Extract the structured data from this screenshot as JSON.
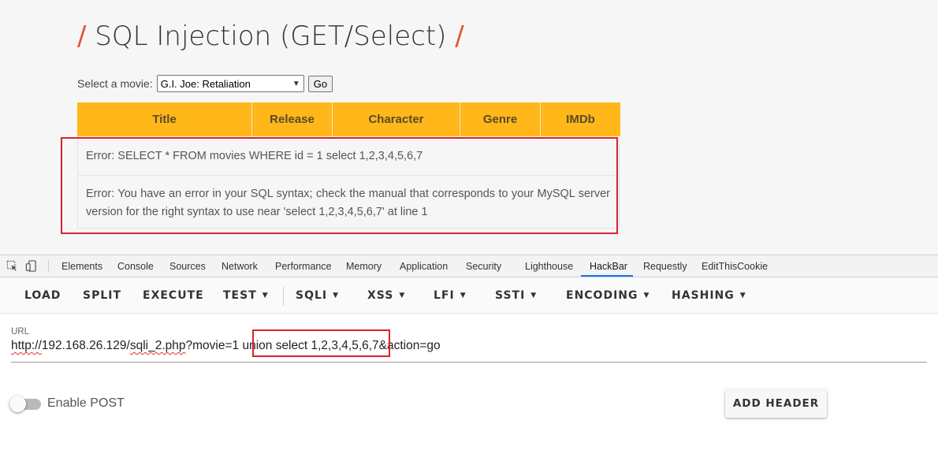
{
  "page": {
    "title": "SQL Injection (GET/Select)",
    "slash": "/",
    "select_label": "Select a movie:",
    "selected_movie": "G.I. Joe: Retaliation",
    "go_label": "Go",
    "table_headers": [
      "Title",
      "Release",
      "Character",
      "Genre",
      "IMDb"
    ],
    "error_1": "Error: SELECT * FROM movies WHERE id = 1 select 1,2,3,4,5,6,7",
    "error_2": "Error: You have an error in your SQL syntax; check the manual that corresponds to your MySQL server version for the right syntax to use near 'select 1,2,3,4,5,6,7' at line 1"
  },
  "devtools": {
    "tabs": [
      "Elements",
      "Console",
      "Sources",
      "Network",
      "Performance",
      "Memory",
      "Application",
      "Security",
      "Lighthouse",
      "HackBar",
      "Requestly",
      "EditThisCookie"
    ],
    "active_tab": "HackBar"
  },
  "hackbar": {
    "buttons": [
      "LOAD",
      "SPLIT",
      "EXECUTE",
      "TEST",
      "SQLI",
      "XSS",
      "LFI",
      "SSTI",
      "ENCODING",
      "HASHING"
    ],
    "url_label": "URL",
    "url_part_1": "http://",
    "url_part_2": "192.168.26.129/",
    "url_part_3": "sqli_2.php",
    "url_part_4": "?movie=1 union select 1,2,3,4,5,6,7&action=go",
    "enable_post_label": "Enable POST",
    "add_header_label": "ADD HEADER"
  },
  "colors": {
    "accent_orange": "#ffb71a",
    "slash_orange": "#e8532b",
    "highlight_red": "#d9232d",
    "tab_blue": "#1a73e8"
  }
}
